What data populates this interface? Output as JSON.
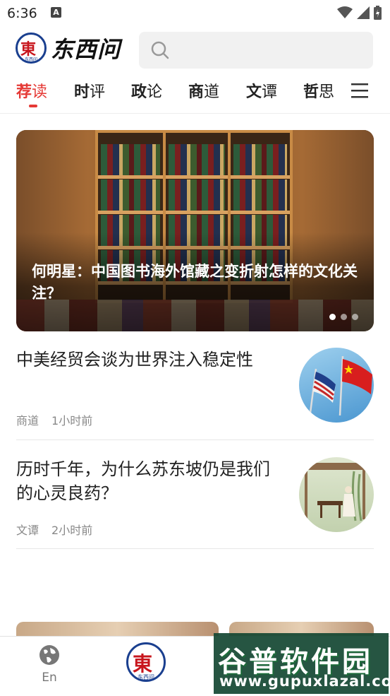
{
  "status_bar": {
    "time": "6:36",
    "notification_badge": "A"
  },
  "header": {
    "logo_text": "东西问",
    "logo_badge_char": "東",
    "logo_badge_sub": "东西问",
    "search_placeholder": ""
  },
  "tabs": [
    {
      "bold": "荐",
      "rest": "读",
      "active": true
    },
    {
      "bold": "时",
      "rest": "评",
      "active": false
    },
    {
      "bold": "政",
      "rest": "论",
      "active": false
    },
    {
      "bold": "商",
      "rest": "道",
      "active": false
    },
    {
      "bold": "文",
      "rest": "谭",
      "active": false
    },
    {
      "bold": "哲",
      "rest": "思",
      "active": false
    }
  ],
  "banner": {
    "title": "何明星：中国图书海外馆藏之变折射怎样的文化关注？",
    "slide_count": 3,
    "active_slide": 1
  },
  "news": [
    {
      "title": "中美经贸会谈为世界注入稳定性",
      "category": "商道",
      "time": "1小时前"
    },
    {
      "title": "历时千年，为什么苏东坡仍是我们的心灵良药？",
      "category": "文谭",
      "time": "2小时前"
    }
  ],
  "bottom_nav": {
    "en_label": "En",
    "home_badge_char": "東",
    "home_badge_sub": "东西问"
  },
  "watermark": {
    "title": "谷普软件园",
    "url": "www.gupuxlazal.com"
  },
  "colors": {
    "accent": "#e53935",
    "brand_blue": "#1a3f8f",
    "brand_red": "#c8161d",
    "meta_gray": "#888888"
  }
}
